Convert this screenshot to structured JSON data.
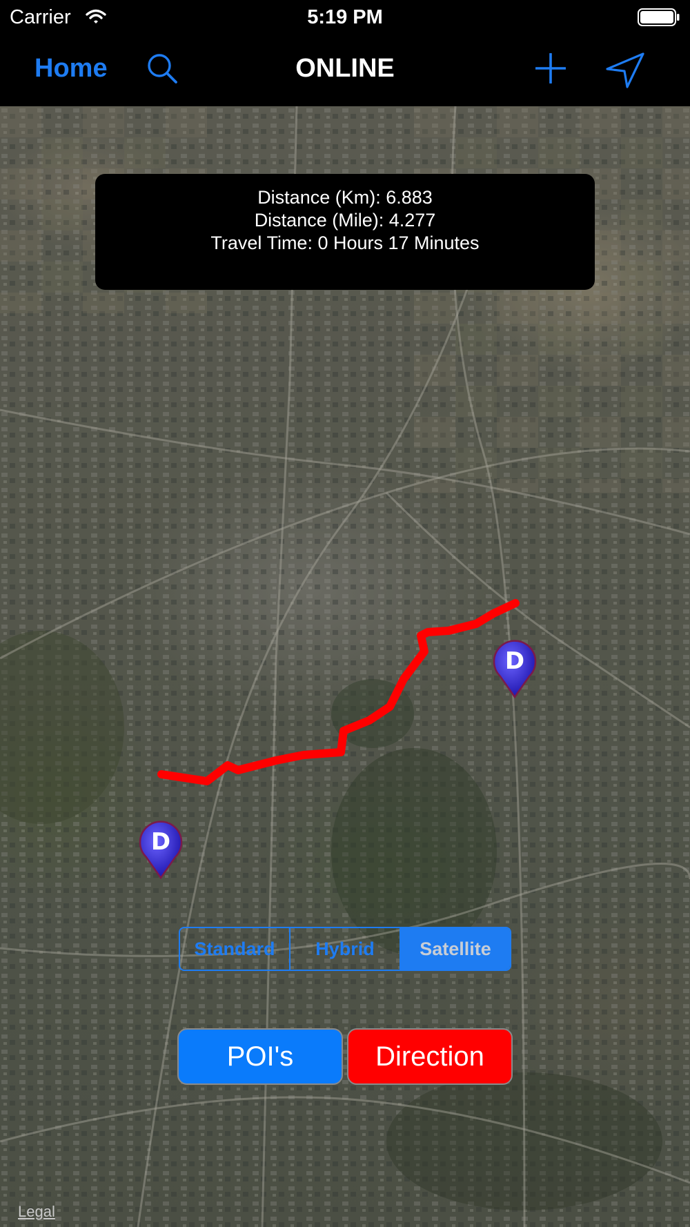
{
  "status_bar": {
    "carrier": "Carrier",
    "time": "5:19 PM"
  },
  "nav": {
    "home_label": "Home",
    "title": "ONLINE",
    "icons": [
      "search-icon",
      "plus-icon",
      "location-arrow-icon"
    ],
    "accent_color": "#1e7cf2"
  },
  "info": {
    "distance_km": "Distance (Km): 6.883",
    "distance_mile": "Distance (Mile): 4.277",
    "travel_time": "Travel Time: 0 Hours 17 Minutes"
  },
  "map": {
    "pins": [
      {
        "label": "D"
      },
      {
        "label": "D"
      }
    ],
    "route_color": "#ff0000",
    "legal": "Legal"
  },
  "map_type": {
    "options": [
      "Standard",
      "Hybrid",
      "Satellite"
    ],
    "selected": "Satellite"
  },
  "buttons": {
    "poi": "POI's",
    "direction": "Direction",
    "poi_color": "#0a7bfb",
    "direction_color": "#ff0000"
  }
}
